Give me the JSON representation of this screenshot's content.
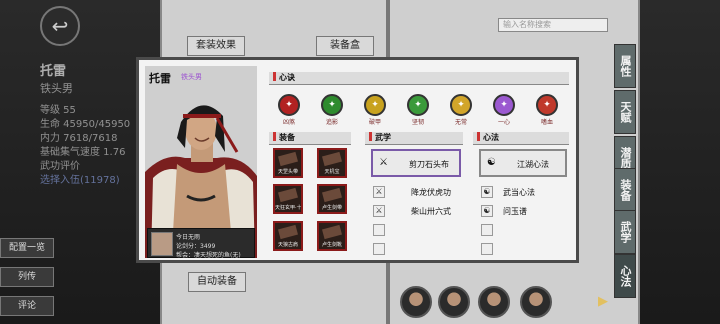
{
  "background": {
    "character": {
      "name": "托雷",
      "title": "铁头男",
      "stats": [
        "等级 55",
        "生命 45950/45950",
        "内力 7618/7618",
        "基础集气速度 1.76",
        "武功评价",
        "选择入伍(11978)"
      ]
    },
    "buttons": {
      "set_effect": "套装效果",
      "equip_box": "装备盒",
      "auto_equip": "自动装备"
    },
    "left_menu": [
      "配置一览",
      "列传",
      "评论"
    ],
    "search_placeholder": "输入名称搜索",
    "side_tabs": [
      "属性",
      "天赋",
      "潜质",
      "装备",
      "武学",
      "心法"
    ],
    "next_icon": "chevron-right-icon"
  },
  "modal": {
    "name": "托雷",
    "title": "铁头男",
    "info": {
      "line1": "今日无雨",
      "line2": "论剑分：3499",
      "line3": "帮会：凄天想死的鱼(无)"
    },
    "sections": {
      "xinjue": "心诀",
      "equip": "装备",
      "wuxue": "武学",
      "xinfa": "心法"
    },
    "xinjue_icons": [
      {
        "label": "凶煞",
        "icon": "blood-orb-icon",
        "color": "#b22222"
      },
      {
        "label": "追影",
        "icon": "wind-orb-icon",
        "color": "#2e8b2e"
      },
      {
        "label": "破甲",
        "icon": "gold-orb-icon",
        "color": "#c8a21e"
      },
      {
        "label": "坚韧",
        "icon": "green-orb-icon",
        "color": "#3a9a3a"
      },
      {
        "label": "无常",
        "icon": "yellow-orb-icon",
        "color": "#d2a52a"
      },
      {
        "label": "一心",
        "icon": "purple-orb-icon",
        "color": "#9b59d0"
      },
      {
        "label": "嗜血",
        "icon": "red-orb-icon",
        "color": "#c0392b"
      }
    ],
    "equipment": [
      "天罡头带",
      "天机宝",
      "天狂玄甲·十",
      "卢生剑带",
      "天狼古肩",
      "卢生剑靴"
    ],
    "wuxue": {
      "main": "剪刀石头布",
      "items": [
        "降龙伏虎功",
        "柴山卅六式"
      ]
    },
    "xinfa": {
      "main": "江湖心法",
      "items": [
        "武当心法",
        "问玉谱"
      ]
    }
  }
}
